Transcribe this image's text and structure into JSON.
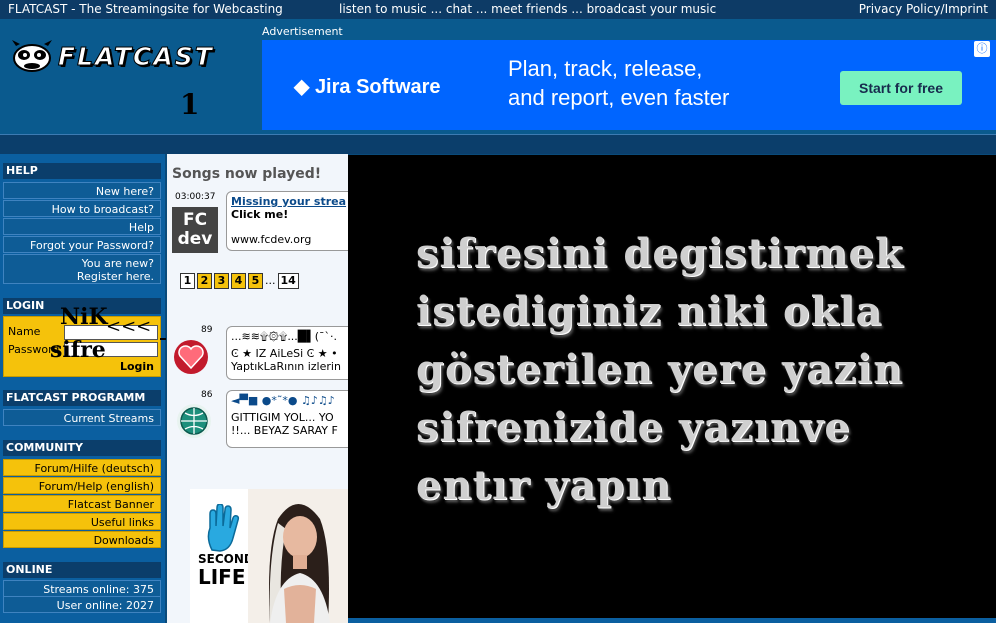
{
  "topbar": {
    "site_title": "FLATCAST - The Streamingsite for Webcasting",
    "slogan": "listen to music ... chat ... meet friends ... broadcast your music",
    "privacy_link": "Privacy Policy/Imprint"
  },
  "header": {
    "logo_text": "FLATCAST",
    "logo_annotation": "1"
  },
  "ad": {
    "label": "Advertisement",
    "brand": "◆ Jira Software",
    "headline_line1": "Plan, track, release,",
    "headline_line2": "and report, even faster",
    "cta": "Start for free",
    "info_icon": "ⓘ"
  },
  "sidebar": {
    "help": {
      "title": "HELP",
      "items": [
        "New here?",
        "How to broadcast?",
        "Help",
        "Forgot your Password?"
      ],
      "new_user_line1": "You are new?",
      "new_user_line2": "Register here."
    },
    "login": {
      "title": "LOGIN",
      "name_label": "Name",
      "password_label": "Password",
      "button": "Login"
    },
    "programm": {
      "title": "FLATCAST PROGRAMM",
      "items": [
        "Current Streams"
      ]
    },
    "community": {
      "title": "COMMUNITY",
      "items": [
        "Forum/Hilfe (deutsch)",
        "Forum/Help (english)",
        "Flatcast Banner",
        "Useful links",
        "Downloads"
      ]
    },
    "online": {
      "title": "ONLINE",
      "streams": "Streams online: 375",
      "users": "User online: 2027"
    }
  },
  "annotations": {
    "nik": "NiK",
    "arrows": "<<<",
    "sifre": "sifre"
  },
  "content": {
    "title": "Songs now played!",
    "songs": [
      {
        "time": "03:00:37",
        "link": "Missing your strea",
        "line2": "Click me!",
        "line3": "www.fcdev.org"
      },
      {
        "time": "89",
        "line1": "...≋≋۩۞۩...█▌(¯`·.",
        "line2": "Ͼ ★ IZ AiLeSi Ͼ ★ •",
        "line3": "YaptıkLaRının izlerin"
      },
      {
        "time": "86",
        "line1": "◄▀■ ●*˜*● ♫♪♫♪",
        "line2": "GITTIGIM YOL... YO",
        "line3": "!!... BEYAZ SARAY F"
      }
    ],
    "fc_logo_top": "FC",
    "fc_logo_bottom": "dev",
    "pages": [
      "1",
      "2",
      "3",
      "4",
      "5",
      "...",
      "14"
    ],
    "promo_line1": "SECOND",
    "promo_line2": "LIFE"
  },
  "overlay": {
    "lines": [
      "sifresini  degistirmek",
      "istediginiz  niki  okla",
      "gösterilen yere yazin",
      "sifrenizide  yazınve",
      "entır yapın"
    ]
  }
}
